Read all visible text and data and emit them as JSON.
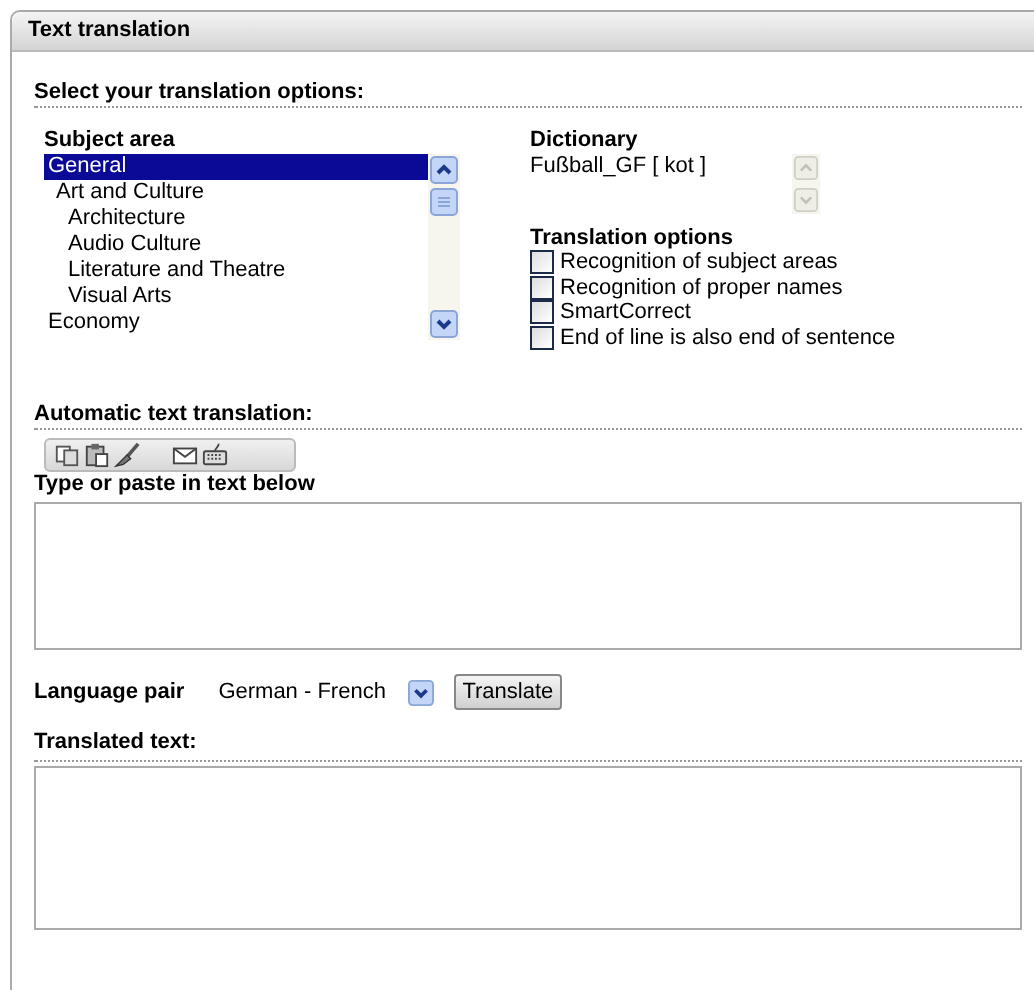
{
  "panel": {
    "title": "Text translation"
  },
  "options_heading": "Select your translation options:",
  "subject_area": {
    "label": "Subject area",
    "items": [
      {
        "label": "General",
        "selected": true
      },
      {
        "label": "Art and Culture",
        "selected": false,
        "children": [
          {
            "label": "Architecture",
            "selected": false
          },
          {
            "label": "Audio Culture",
            "selected": false
          },
          {
            "label": "Literature and Theatre",
            "selected": false
          },
          {
            "label": "Visual Arts",
            "selected": false
          }
        ]
      },
      {
        "label": "Economy",
        "selected": false
      }
    ]
  },
  "dictionary": {
    "label": "Dictionary",
    "items": [
      "Fußball_GF [ kot ]"
    ]
  },
  "translation_options": {
    "label": "Translation options",
    "items": [
      {
        "label": "Recognition of subject areas",
        "checked": false
      },
      {
        "label": "Recognition of proper names",
        "checked": false
      },
      {
        "label": "SmartCorrect",
        "checked": false
      },
      {
        "label": "End of line is also end of sentence",
        "checked": false
      }
    ]
  },
  "automatic_heading": "Automatic text translation:",
  "toolbar": [
    {
      "kind": "copy"
    },
    {
      "kind": "paste"
    },
    {
      "kind": "brush"
    },
    {
      "kind": "mail"
    },
    {
      "kind": "keyboard"
    }
  ],
  "input_label": "Type or paste in text below",
  "language_pair": {
    "label": "Language pair",
    "value": "German - French"
  },
  "translate_button": "Translate",
  "translated_label": "Translated text:"
}
